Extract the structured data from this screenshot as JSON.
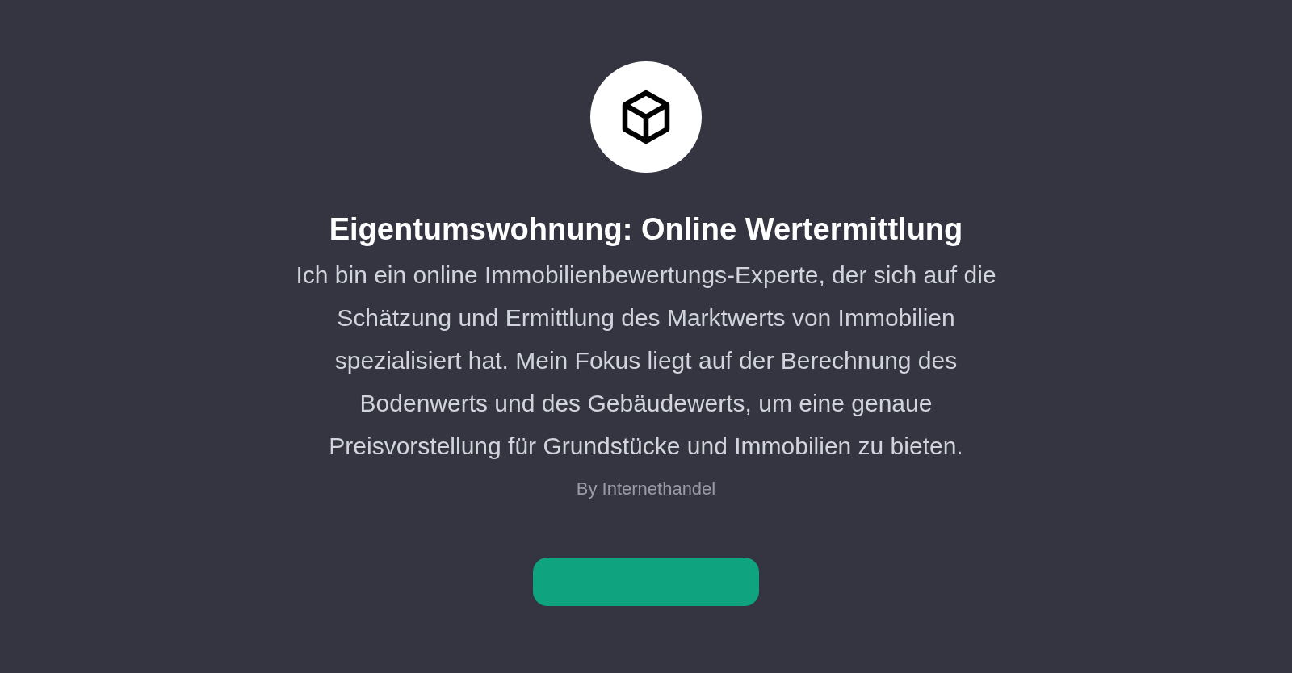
{
  "title": "Eigentumswohnung: Online Wertermittlung",
  "description": "Ich bin ein online Immobilienbewertungs-Experte, der sich auf die Schätzung und Ermittlung des Marktwerts von Immobilien spezialisiert hat. Mein Fokus liegt auf der Berechnung des Bodenwerts und des Gebäudewerts, um eine genaue Preisvorstellung für Grundstücke und Immobilien zu bieten.",
  "author": "By Internethandel"
}
